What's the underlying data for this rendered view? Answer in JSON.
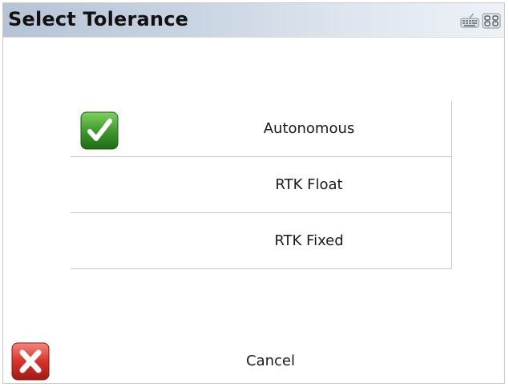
{
  "header": {
    "title": "Select Tolerance",
    "icons": [
      "keyboard-icon",
      "grid-icon"
    ]
  },
  "options": [
    {
      "label": "Autonomous",
      "selected": true
    },
    {
      "label": "RTK Float",
      "selected": false
    },
    {
      "label": "RTK Fixed",
      "selected": false
    }
  ],
  "footer": {
    "cancel_label": "Cancel"
  },
  "colors": {
    "check_green": "#3f9b2d",
    "cancel_red": "#d9322b"
  }
}
